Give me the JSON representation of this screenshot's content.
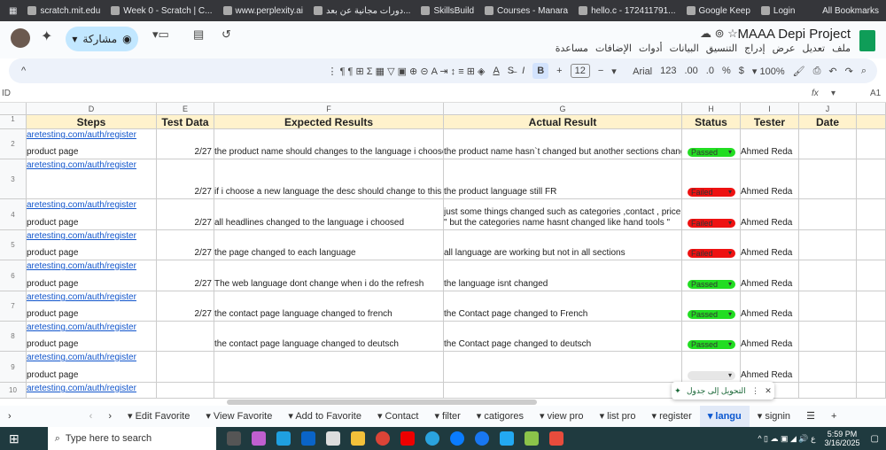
{
  "bookmarks": [
    "scratch.mit.edu",
    "Week 0 - Scratch | C...",
    "www.perplexity.ai",
    "دورات مجانية عن بعد...",
    "SkillsBuild",
    "Courses - Manara",
    "hello.c - 172411791...",
    "Google Keep",
    "Login"
  ],
  "all_bookmarks": "All Bookmarks",
  "doc_title": "MAAA Depi Project",
  "menus": [
    "ملف",
    "تعديل",
    "عرض",
    "إدراج",
    "التنسيق",
    "البيانات",
    "أدوات",
    "الإضافات",
    "مساعدة"
  ],
  "share_label": "مشاركة",
  "toolbar": {
    "zoom": "100%",
    "currency": "$",
    "percent": "%",
    "dec_dec": ".0",
    "inc_dec": ".00",
    "num_fmt": "123",
    "font": "Arial",
    "font_size": "12",
    "bold": "B",
    "italic": "I"
  },
  "formula_bar": {
    "cell_ref": "A1",
    "value": "ID",
    "fx": "fx"
  },
  "columns": [
    "D",
    "E",
    "F",
    "G",
    "H",
    "I",
    "J"
  ],
  "headers": [
    "Steps",
    "Test Data",
    "Expected Results",
    "Actual Result",
    "Status",
    "Tester",
    "Date"
  ],
  "status_colors": {
    "Passed": "#22dd22",
    "Failed": "#ee1111",
    "": "#e6e6e6"
  },
  "rows": [
    {
      "n": "2",
      "link": "aretesting.com/auth/register",
      "step": "product page",
      "data": "2/27",
      "expected": "the product name should changes to the language i choosed",
      "actual": "the product name hasn`t changed but another sections changed",
      "actual2": "",
      "status": "Passed",
      "tester": "Ahmed Reda"
    },
    {
      "n": "3",
      "link": "aretesting.com/auth/register",
      "step": "",
      "data": "2/27",
      "expected": "if i choose a new language the desc should change to this languag",
      "actual": "the product language still FR",
      "actual2": "",
      "status": "Failed",
      "tester": "Ahmed Reda"
    },
    {
      "n": "4",
      "link": "aretesting.com/auth/register",
      "step": "product page",
      "data": "2/27",
      "expected": "all headlines changed to the language i choosed",
      "actual": "\" but the categories name hasnt changed like hand tools \"",
      "actual2": "just some things changed such as categories ,contact , price",
      "status": "Failed",
      "tester": "Ahmed Reda"
    },
    {
      "n": "5",
      "link": "aretesting.com/auth/register",
      "step": "product page",
      "data": "2/27",
      "expected": "the page changed to each language",
      "actual": "all language are working but not in all sections",
      "actual2": "",
      "status": "Failed",
      "tester": "Ahmed Reda"
    },
    {
      "n": "6",
      "link": "aretesting.com/auth/register",
      "step": "product page",
      "data": "2/27",
      "expected": "The web language dont change when i do the refresh",
      "actual": "the language isnt changed",
      "actual2": "",
      "status": "Passed",
      "tester": "Ahmed Reda"
    },
    {
      "n": "7",
      "link": "aretesting.com/auth/register",
      "step": "product page",
      "data": "2/27",
      "expected": "the contact page language changed to french",
      "actual": "the Contact page changed to French",
      "actual2": "",
      "status": "Passed",
      "tester": "Ahmed Reda"
    },
    {
      "n": "8",
      "link": "aretesting.com/auth/register",
      "step": "product page",
      "data": "",
      "expected": "the contact page language changed to deutsch",
      "actual": "the Contact page changed to deutsch",
      "actual2": "",
      "status": "Passed",
      "tester": "Ahmed Reda"
    },
    {
      "n": "9",
      "link": "aretesting.com/auth/register",
      "step": "product page",
      "data": "",
      "expected": "",
      "actual": "",
      "actual2": "",
      "status": "",
      "tester": "Ahmed Reda"
    },
    {
      "n": "10",
      "link": "aretesting.com/auth/register",
      "step": "",
      "data": "",
      "expected": "",
      "actual": "",
      "actual2": "",
      "status": "",
      "tester": ""
    }
  ],
  "float_chip": "التحويل إلى جدول",
  "sheet_tabs": [
    "Edit Favorite",
    "View Favorite",
    "Add to Favorite",
    "Contact",
    "filter",
    "catigores",
    "view pro",
    "list pro",
    "register",
    "langu",
    "signin"
  ],
  "active_tab": "langu",
  "taskbar": {
    "search": "Type here to search",
    "time": "5:59 PM",
    "date": "3/16/2025"
  }
}
